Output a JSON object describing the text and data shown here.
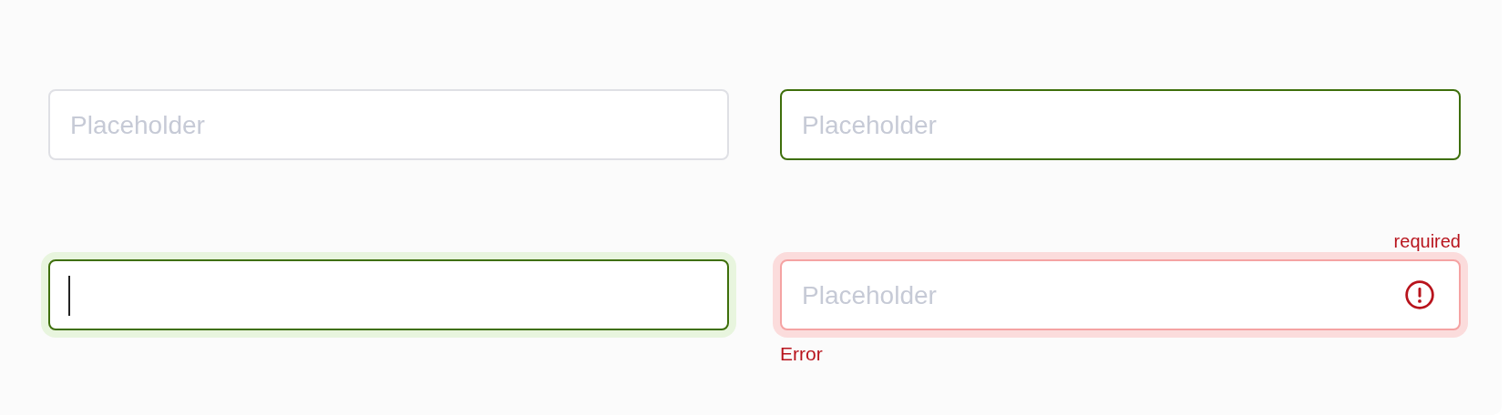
{
  "fields": [
    {
      "kind": "default",
      "placeholder": "Placeholder"
    },
    {
      "kind": "hover",
      "placeholder": "Placeholder"
    },
    {
      "kind": "focus"
    },
    {
      "kind": "error",
      "placeholder": "Placeholder",
      "hint": "required",
      "message": "Error"
    }
  ]
}
